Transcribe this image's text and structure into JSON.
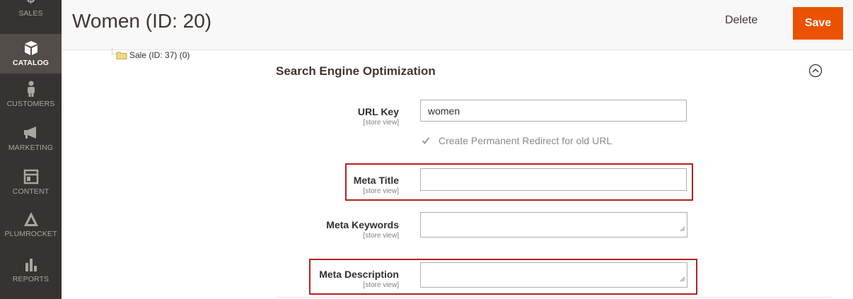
{
  "sidebar": {
    "items": [
      {
        "label": "SALES",
        "icon": "dollar-icon"
      },
      {
        "label": "CATALOG",
        "icon": "cube-icon"
      },
      {
        "label": "CUSTOMERS",
        "icon": "person-icon"
      },
      {
        "label": "MARKETING",
        "icon": "megaphone-icon"
      },
      {
        "label": "CONTENT",
        "icon": "layout-icon"
      },
      {
        "label": "PLUMROCKET",
        "icon": "plumrocket-icon"
      },
      {
        "label": "REPORTS",
        "icon": "bar-chart-icon"
      }
    ],
    "active": "CATALOG"
  },
  "header": {
    "title": "Women (ID: 20)",
    "delete_label": "Delete",
    "save_label": "Save"
  },
  "tree": {
    "item": "Sale (ID: 37) (0)"
  },
  "seo": {
    "title": "Search Engine Optimization",
    "url_key": {
      "label": "URL Key",
      "scope": "[store view]",
      "value": "women"
    },
    "redirect": {
      "label": "Create Permanent Redirect for old URL",
      "checked": true
    },
    "meta_title": {
      "label": "Meta Title",
      "scope": "[store view]",
      "value": ""
    },
    "meta_keywords": {
      "label": "Meta Keywords",
      "scope": "[store view]",
      "value": ""
    },
    "meta_description": {
      "label": "Meta Description",
      "scope": "[store view]",
      "value": ""
    }
  },
  "colors": {
    "accent": "#eb5202",
    "sidebar": "#373330",
    "highlight": "#b22222"
  }
}
